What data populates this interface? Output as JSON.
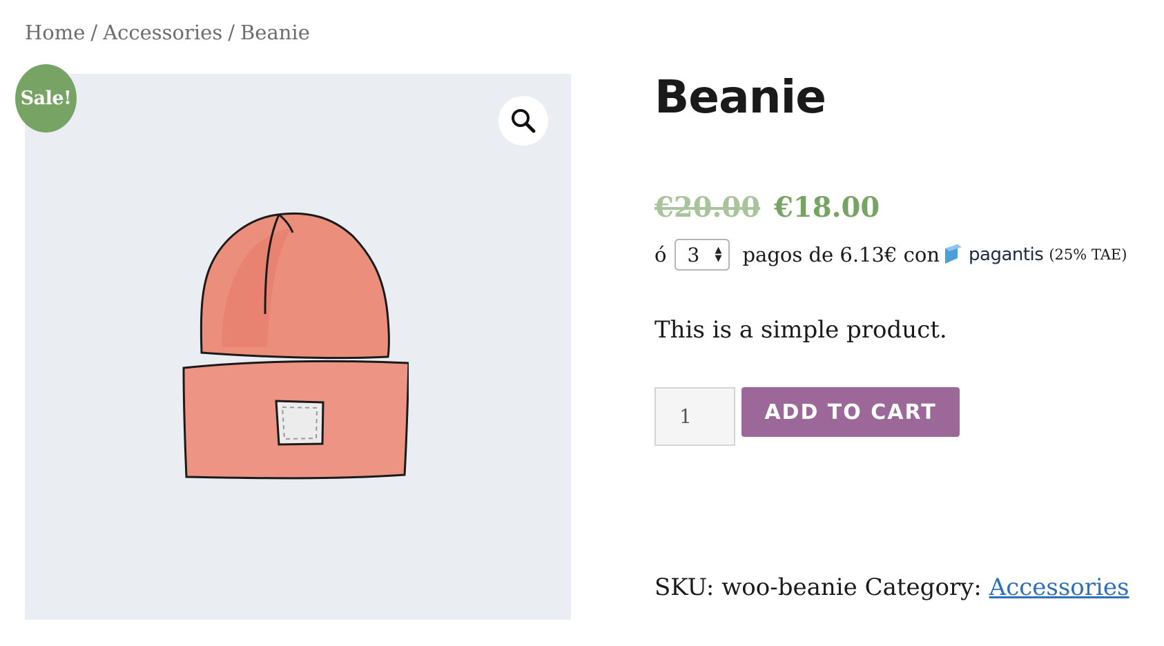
{
  "breadcrumb": {
    "home": "Home",
    "separator": "/",
    "category": "Accessories",
    "current": "Beanie"
  },
  "gallery": {
    "sale_badge": "Sale!",
    "zoom_icon": "search-icon",
    "image": "beanie-illustration"
  },
  "product": {
    "title": "Beanie",
    "regular_price": "€20.00",
    "sale_price": "€18.00",
    "short_description": "This is a simple product."
  },
  "installments": {
    "prefix": "ó",
    "selected_count": "3",
    "text": "pagos de 6.13€ con",
    "provider": "pagantis",
    "rate": "(25% TAE)"
  },
  "cart": {
    "quantity": "1",
    "add_to_cart_label": "ADD TO CART"
  },
  "meta": {
    "sku_label": "SKU:",
    "sku_value": "woo-beanie",
    "category_label": "Category:",
    "category_link": "Accessories"
  },
  "colors": {
    "sale_green": "#77a464",
    "button_purple": "#9b6899",
    "link_blue": "#2d6fb8",
    "gallery_bg": "#eaedf2"
  }
}
